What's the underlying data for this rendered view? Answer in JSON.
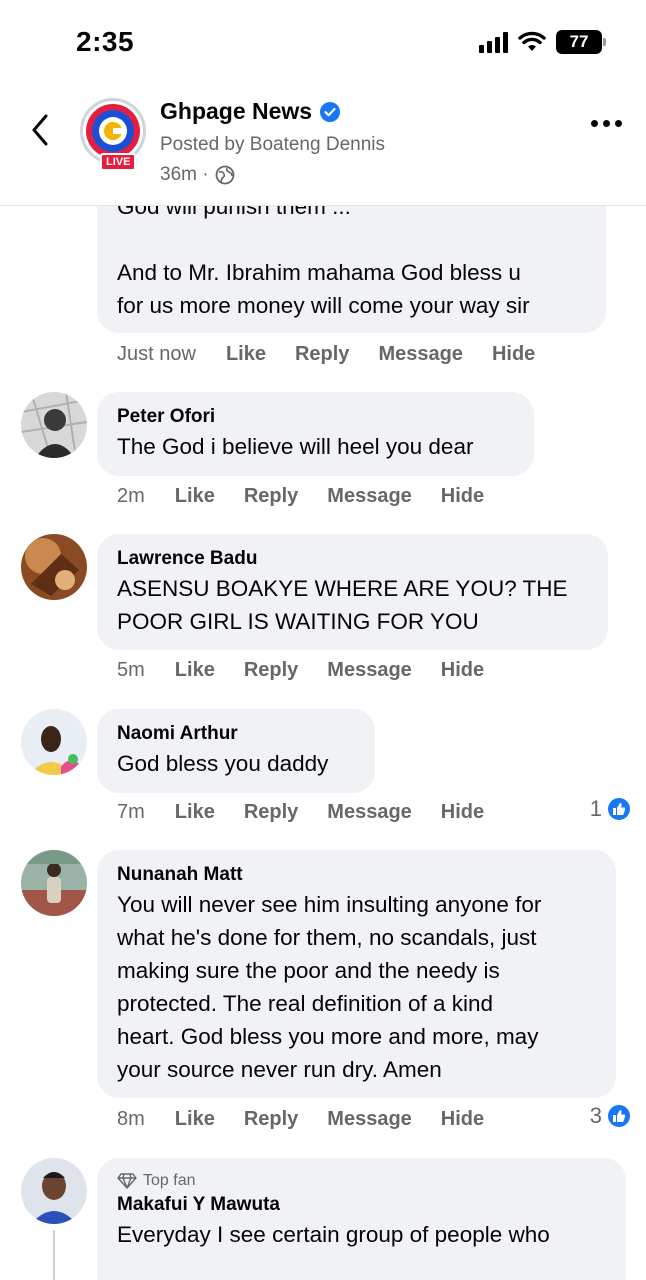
{
  "status_bar": {
    "time": "2:35",
    "battery": "77"
  },
  "header": {
    "page_name": "Ghpage News",
    "posted_by": "Posted by Boateng Dennis",
    "time": "36m ·",
    "live_label": "LIVE"
  },
  "colors": {
    "like_blue": "#1877f2",
    "bubble_bg": "#f0f2f5",
    "meta_gray": "#65676b",
    "live_red": "#e41e3f"
  },
  "actions": {
    "like": "Like",
    "reply": "Reply",
    "message": "Message",
    "hide": "Hide"
  },
  "comments": [
    {
      "lines": [
        "God will punish them ...",
        "",
        "And to Mr. Ibrahim mahama God bless u",
        "for us more money will come your way sir"
      ],
      "time": "Just now"
    },
    {
      "author": "Peter Ofori",
      "text": "The God i believe will heel you dear",
      "time": "2m"
    },
    {
      "author": "Lawrence Badu",
      "lines": [
        "ASENSU BOAKYE WHERE ARE YOU? THE",
        "POOR GIRL IS WAITING FOR YOU"
      ],
      "time": "5m"
    },
    {
      "author": "Naomi Arthur",
      "text": "God bless you daddy",
      "time": "7m",
      "reactions": "1"
    },
    {
      "author": "Nunanah Matt",
      "lines": [
        "You will never see him insulting anyone for",
        "what he's done for them, no scandals, just",
        "making sure the poor and the needy is",
        "protected. The real definition of a kind",
        "heart. God bless you more and more, may",
        "your source never run dry. Amen"
      ],
      "time": "8m",
      "reactions": "3"
    },
    {
      "badge": "Top fan",
      "author": "Makafui Y Mawuta",
      "text": "Everyday I see certain group of people who"
    }
  ],
  "icons": [
    "back-arrow-icon",
    "verified-badge-icon",
    "globe-icon",
    "more-dots-icon",
    "like-thumb-icon",
    "diamond-icon",
    "signal-icon",
    "wifi-icon",
    "battery-icon"
  ]
}
